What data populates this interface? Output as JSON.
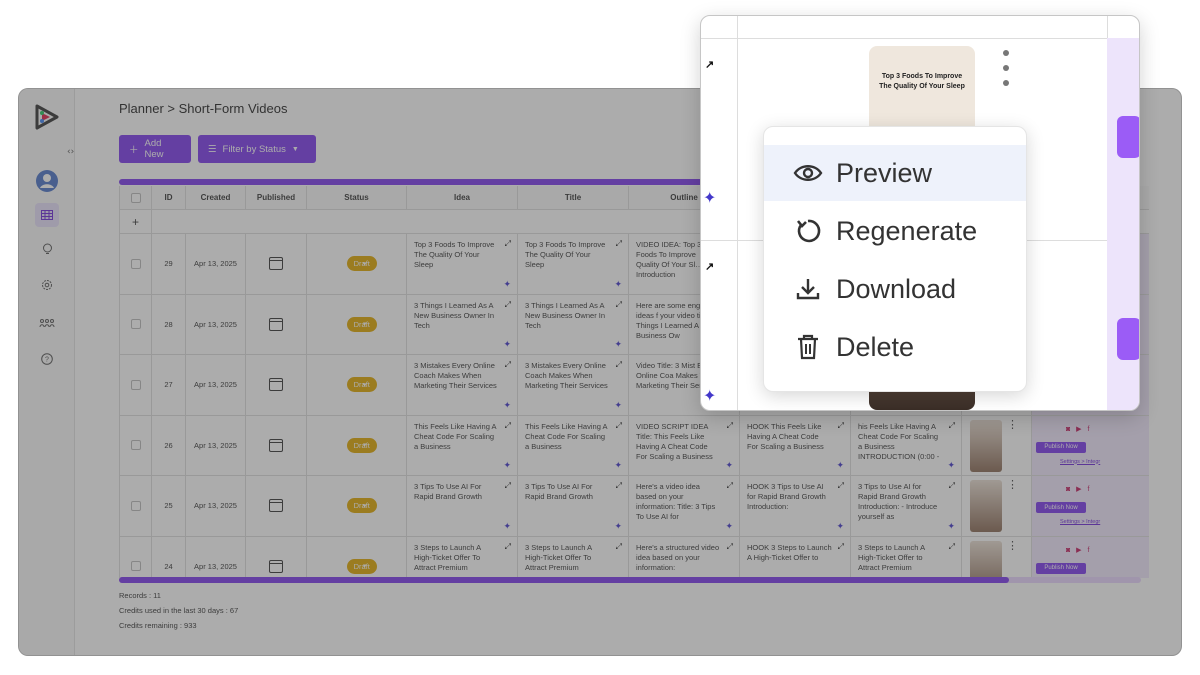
{
  "breadcrumb": "Planner > Short-Form Videos",
  "toolbar": {
    "add_new": "Add New",
    "filter": "Filter by Status"
  },
  "columns": [
    "ID",
    "Created",
    "Published",
    "Status",
    "Idea",
    "Title",
    "Outline"
  ],
  "add_row_symbol": "+",
  "rows": [
    {
      "id": "29",
      "created": "Apr 13, 2025",
      "status": "Draft",
      "idea": "Top 3 Foods To Improve The Quality Of Your Sleep",
      "title": "Top 3 Foods To Improve The Quality Of Your Sleep",
      "outline": "VIDEO IDEA: Top 3 Foods To Improve Quality Of Your Sl… 1. Introduction",
      "hook": "",
      "script": ""
    },
    {
      "id": "28",
      "created": "Apr 13, 2025",
      "status": "Draft",
      "idea": "3 Things I Learned As A New Business Owner In Tech",
      "title": "3 Things I Learned As A New Business Owner In Tech",
      "outline": "Here are some engaging ideas f your video titled 3 Things I Learned A New Business Ow",
      "hook": "",
      "script": ""
    },
    {
      "id": "27",
      "created": "Apr 13, 2025",
      "status": "Draft",
      "idea": "3 Mistakes Every Online Coach Makes When Marketing Their Services",
      "title": "3 Mistakes Every Online Coach Makes When Marketing Their Services",
      "outline": "Video Title: 3 Mist Every Online Coa Makes When Marketing Their Services",
      "hook": "",
      "script": ""
    },
    {
      "id": "26",
      "created": "Apr 13, 2025",
      "status": "Draft",
      "idea": "This Feels Like Having A Cheat Code For Scaling a Business",
      "title": "This Feels Like Having A Cheat Code For Scaling a Business",
      "outline": "VIDEO SCRIPT IDEA  Title: This Feels Like Having A Cheat Code For Scaling a Business",
      "hook": "HOOK This Feels Like Having A Cheat Code For Scaling a Business",
      "script": "his Feels Like Having A Cheat Code For Scaling a Business  INTRODUCTION (0:00 -"
    },
    {
      "id": "25",
      "created": "Apr 13, 2025",
      "status": "Draft",
      "idea": "3 Tips To Use AI For Rapid Brand Growth",
      "title": "3 Tips To Use AI For Rapid Brand Growth",
      "outline": "Here's a video idea based on your information:  Title: 3 Tips To Use AI for",
      "hook": "HOOK 3 Tips to Use AI for Rapid Brand Growth  Introduction:",
      "script": "3 Tips to Use AI for Rapid Brand Growth  Introduction: - Introduce yourself as"
    },
    {
      "id": "24",
      "created": "Apr 13, 2025",
      "status": "Draft",
      "idea": "3 Steps to Launch A High-Ticket Offer To Attract Premium",
      "title": "3 Steps to Launch A High-Ticket Offer To Attract Premium",
      "outline": "Here's a structured video idea based on your information:",
      "hook": "HOOK 3 Steps to Launch A High-Ticket Offer to",
      "script": "3 Steps to Launch A High-Ticket Offer to Attract Premium"
    }
  ],
  "publish_label": "Publish Now",
  "settings_link": "Settings > Integr",
  "footer": {
    "records": "Records : 11",
    "credits_used": "Credits used in the last 30 days : 67",
    "credits_remaining": "Credits remaining : 933"
  },
  "zoom": {
    "thumbnail_title": "Top 3 Foods To Improve The Quality Of Your Sleep",
    "menu": [
      {
        "label": "Preview",
        "icon": "eye-icon"
      },
      {
        "label": "Regenerate",
        "icon": "refresh-icon"
      },
      {
        "label": "Download",
        "icon": "download-icon"
      },
      {
        "label": "Delete",
        "icon": "trash-icon"
      }
    ]
  },
  "colors": {
    "accent": "#7c3aed",
    "draft": "#e0a800",
    "overlay": "rgba(70,70,70,0.45)"
  }
}
